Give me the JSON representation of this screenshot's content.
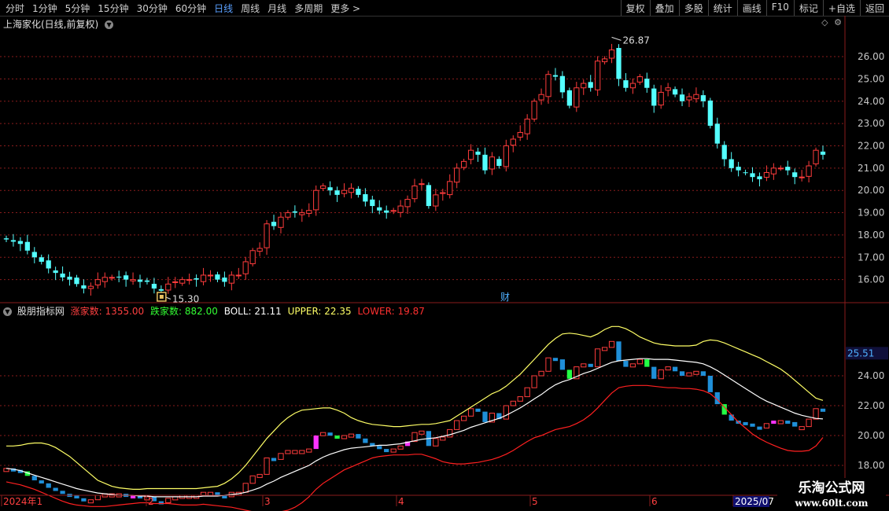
{
  "toolbar": {
    "periods": [
      "分时",
      "1分钟",
      "5分钟",
      "15分钟",
      "30分钟",
      "60分钟",
      "日线",
      "周线",
      "月线",
      "多周期",
      "更多"
    ],
    "active_period": "日线",
    "right_buttons": [
      "复权",
      "叠加",
      "多股",
      "统计",
      "画线",
      "F10",
      "标记",
      "+自选",
      "返回"
    ]
  },
  "main_chart": {
    "title": "上海家化(日线,前复权)",
    "high_label": "26.87",
    "low_label": "15.30",
    "fin_marker": "财"
  },
  "indicator": {
    "name": "股朋指标网",
    "zhangjia_label": "涨家数:",
    "zhangjia_value": "1355.00",
    "diejia_label": "跌家数:",
    "diejia_value": "882.00",
    "boll_label": "BOLL:",
    "boll_value": "21.11",
    "upper_label": "UPPER:",
    "upper_value": "22.35",
    "lower_label": "LOWER:",
    "lower_value": "19.87",
    "current_value": "25.51"
  },
  "chart_data": {
    "type": "candlestick",
    "y_axis_ticks": [
      "26.00",
      "25.00",
      "24.00",
      "23.00",
      "22.00",
      "21.00",
      "20.00",
      "19.00",
      "18.00",
      "17.00",
      "16.00"
    ],
    "ylim": [
      15.0,
      27.2
    ],
    "ind_y_axis_ticks": [
      "24.00",
      "22.00",
      "20.00",
      "18.00"
    ],
    "ind_ylim": [
      16.0,
      28.0
    ],
    "x_axis_labels": [
      "2024年1",
      "2",
      "3",
      "4",
      "5",
      "6",
      "2025/07"
    ],
    "close": [
      17.8,
      17.7,
      17.6,
      17.3,
      17.0,
      16.8,
      16.5,
      16.3,
      16.1,
      16.0,
      15.8,
      15.6,
      15.7,
      16.0,
      16.1,
      16.1,
      16.1,
      16.0,
      16.0,
      15.9,
      15.9,
      15.6,
      15.5,
      15.8,
      15.9,
      16.0,
      16.0,
      16.0,
      16.2,
      16.2,
      16.0,
      15.9,
      16.2,
      16.2,
      16.8,
      17.3,
      17.4,
      18.5,
      18.4,
      18.8,
      19.0,
      19.0,
      19.0,
      19.1,
      20.0,
      20.2,
      20.0,
      19.8,
      20.0,
      20.1,
      19.8,
      19.5,
      19.3,
      19.1,
      19.0,
      19.1,
      19.3,
      19.6,
      20.2,
      20.3,
      19.3,
      19.8,
      19.9,
      20.4,
      21.0,
      21.3,
      21.8,
      21.6,
      20.9,
      21.5,
      21.1,
      22.0,
      22.3,
      22.6,
      23.2,
      24.0,
      24.3,
      25.2,
      25.1,
      24.4,
      23.8,
      24.6,
      24.8,
      24.6,
      25.8,
      25.9,
      26.3,
      25.0,
      24.6,
      24.8,
      25.1,
      24.6,
      23.8,
      24.4,
      24.6,
      24.3,
      24.0,
      24.2,
      24.3,
      24.0,
      22.9,
      22.1,
      21.4,
      21.0,
      20.9,
      20.8,
      20.6,
      20.5,
      20.8,
      21.0,
      21.0,
      20.9,
      20.6,
      20.6,
      21.1,
      21.8,
      21.6
    ],
    "boll": [
      17.8,
      17.75,
      17.65,
      17.5,
      17.35,
      17.2,
      17.05,
      16.9,
      16.75,
      16.6,
      16.45,
      16.35,
      16.25,
      16.15,
      16.1,
      16.05,
      16.0,
      16.0,
      16.0,
      15.95,
      15.95,
      15.9,
      15.9,
      15.9,
      15.9,
      15.9,
      15.9,
      15.9,
      15.95,
      15.95,
      15.95,
      16.0,
      16.05,
      16.1,
      16.2,
      16.35,
      16.5,
      16.75,
      16.95,
      17.2,
      17.4,
      17.6,
      17.8,
      18.0,
      18.3,
      18.55,
      18.75,
      18.9,
      19.05,
      19.15,
      19.2,
      19.25,
      19.3,
      19.35,
      19.35,
      19.4,
      19.45,
      19.55,
      19.65,
      19.75,
      19.8,
      19.85,
      19.95,
      20.05,
      20.2,
      20.35,
      20.55,
      20.7,
      20.85,
      21.0,
      21.15,
      21.35,
      21.6,
      21.85,
      22.15,
      22.45,
      22.75,
      23.1,
      23.4,
      23.6,
      23.75,
      23.95,
      24.15,
      24.3,
      24.5,
      24.7,
      24.9,
      25.0,
      25.05,
      25.1,
      25.15,
      25.15,
      25.1,
      25.1,
      25.1,
      25.05,
      25.0,
      24.95,
      24.9,
      24.8,
      24.6,
      24.35,
      24.05,
      23.75,
      23.45,
      23.15,
      22.85,
      22.55,
      22.3,
      22.1,
      21.9,
      21.7,
      21.5,
      21.35,
      21.25,
      21.15,
      21.11
    ],
    "upper": [
      19.3,
      19.3,
      19.35,
      19.45,
      19.5,
      19.5,
      19.4,
      19.2,
      18.9,
      18.6,
      18.2,
      17.8,
      17.4,
      17.0,
      16.8,
      16.6,
      16.5,
      16.45,
      16.4,
      16.4,
      16.45,
      16.45,
      16.45,
      16.45,
      16.45,
      16.45,
      16.45,
      16.45,
      16.5,
      16.55,
      16.6,
      16.8,
      17.1,
      17.5,
      18.0,
      18.6,
      19.2,
      19.8,
      20.3,
      20.8,
      21.2,
      21.5,
      21.7,
      21.75,
      21.8,
      21.85,
      21.85,
      21.7,
      21.5,
      21.2,
      21.0,
      20.85,
      20.75,
      20.7,
      20.65,
      20.6,
      20.6,
      20.65,
      20.7,
      20.75,
      20.75,
      20.8,
      20.9,
      21.0,
      21.3,
      21.6,
      21.9,
      22.2,
      22.5,
      22.8,
      23.0,
      23.3,
      23.7,
      24.1,
      24.6,
      25.1,
      25.6,
      26.1,
      26.5,
      26.8,
      26.85,
      26.8,
      26.7,
      26.6,
      26.8,
      27.1,
      27.3,
      27.3,
      27.15,
      26.9,
      26.6,
      26.4,
      26.2,
      26.1,
      26.05,
      26.0,
      26.0,
      26.0,
      26.05,
      26.3,
      26.4,
      26.35,
      26.2,
      26.0,
      25.8,
      25.6,
      25.4,
      25.2,
      24.95,
      24.7,
      24.45,
      24.1,
      23.7,
      23.3,
      22.9,
      22.5,
      22.35
    ],
    "lower": [
      16.9,
      16.8,
      16.7,
      16.55,
      16.4,
      16.2,
      16.0,
      15.8,
      15.6,
      15.45,
      15.35,
      15.3,
      15.25,
      15.25,
      15.25,
      15.3,
      15.35,
      15.4,
      15.45,
      15.5,
      15.5,
      15.45,
      15.45,
      15.45,
      15.4,
      15.35,
      15.35,
      15.35,
      15.4,
      15.35,
      15.3,
      15.25,
      15.2,
      15.1,
      15.0,
      14.9,
      14.8,
      14.8,
      14.8,
      14.9,
      15.0,
      15.2,
      15.5,
      15.9,
      16.4,
      16.8,
      17.1,
      17.4,
      17.7,
      17.9,
      18.1,
      18.3,
      18.5,
      18.6,
      18.65,
      18.7,
      18.7,
      18.7,
      18.75,
      18.75,
      18.6,
      18.45,
      18.25,
      18.15,
      18.1,
      18.1,
      18.15,
      18.2,
      18.3,
      18.4,
      18.55,
      18.75,
      19.0,
      19.3,
      19.6,
      19.85,
      20.0,
      20.2,
      20.4,
      20.5,
      20.6,
      20.8,
      21.05,
      21.4,
      21.85,
      22.35,
      22.85,
      23.2,
      23.3,
      23.35,
      23.35,
      23.35,
      23.3,
      23.25,
      23.2,
      23.2,
      23.15,
      23.15,
      23.1,
      23.0,
      22.8,
      22.4,
      21.9,
      21.4,
      20.9,
      20.5,
      20.1,
      19.8,
      19.55,
      19.35,
      19.15,
      19.0,
      18.95,
      18.95,
      19.0,
      19.3,
      19.87
    ]
  },
  "colors": {
    "up": "#ff3c3c",
    "down": "#54ffff",
    "grid": "#8a1c1c",
    "boll": "#ffffff",
    "upper": "#ffff66",
    "lower": "#ff2020",
    "ind_down": "#1f8fd8",
    "ind_green": "#22ff44",
    "ind_magenta": "#ff33ff"
  }
}
